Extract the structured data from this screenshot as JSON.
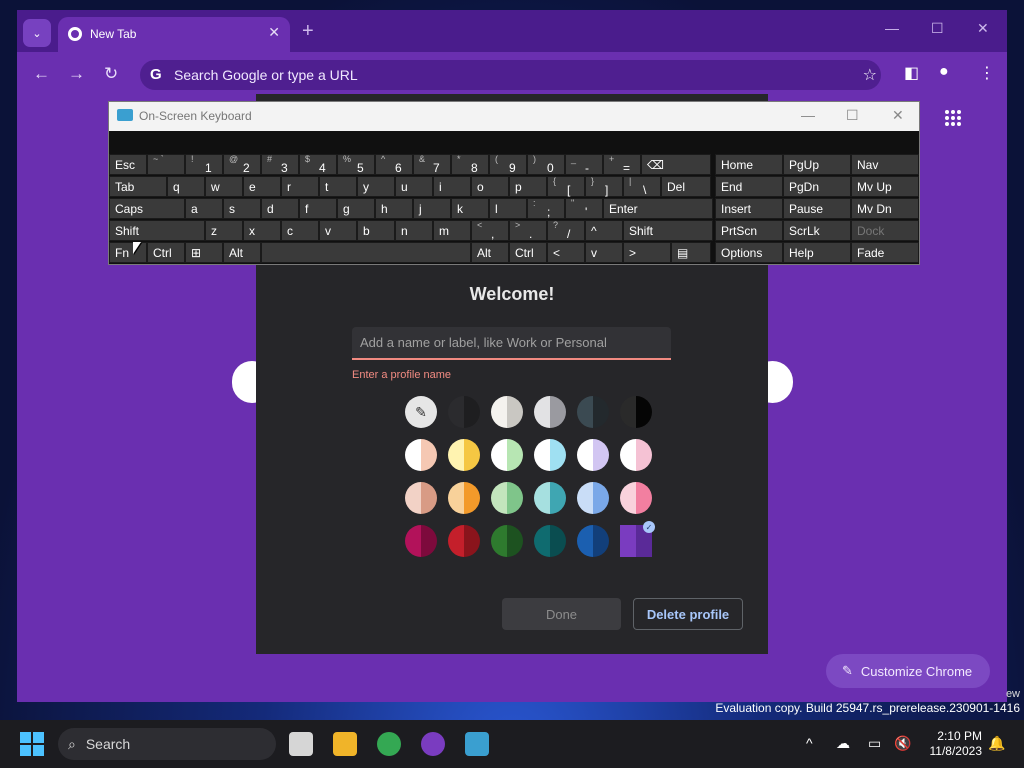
{
  "browser": {
    "tab_title": "New Tab",
    "tab_close": "✕",
    "new_tab": "+",
    "window_controls": [
      "—",
      "☐",
      "✕"
    ],
    "omnibox_placeholder": "Search Google or type a URL",
    "customize_label": "Customize Chrome",
    "theme_color": "#6a2fb0"
  },
  "osk": {
    "title": "On-Screen Keyboard",
    "controls": [
      "—",
      "☐",
      "✕"
    ],
    "rows": [
      [
        [
          "Esc",
          ""
        ],
        [
          "",
          "~ `"
        ],
        [
          "1",
          "!"
        ],
        [
          "2",
          "@"
        ],
        [
          "3",
          "#"
        ],
        [
          "4",
          "$"
        ],
        [
          "5",
          "%"
        ],
        [
          "6",
          "^"
        ],
        [
          "7",
          "&"
        ],
        [
          "8",
          "*"
        ],
        [
          "9",
          "("
        ],
        [
          "0",
          ")"
        ],
        [
          "-",
          "_"
        ],
        [
          "=",
          "+"
        ],
        [
          "⌫",
          ""
        ]
      ],
      [
        [
          "Tab",
          ""
        ],
        [
          "q",
          ""
        ],
        [
          "w",
          ""
        ],
        [
          "e",
          ""
        ],
        [
          "r",
          ""
        ],
        [
          "t",
          ""
        ],
        [
          "y",
          ""
        ],
        [
          "u",
          ""
        ],
        [
          "i",
          ""
        ],
        [
          "o",
          ""
        ],
        [
          "p",
          ""
        ],
        [
          "[",
          "{"
        ],
        [
          "]",
          "}"
        ],
        [
          "\\",
          "|"
        ],
        [
          "Del",
          ""
        ]
      ],
      [
        [
          "Caps",
          ""
        ],
        [
          "a",
          ""
        ],
        [
          "s",
          ""
        ],
        [
          "d",
          ""
        ],
        [
          "f",
          ""
        ],
        [
          "g",
          ""
        ],
        [
          "h",
          ""
        ],
        [
          "j",
          ""
        ],
        [
          "k",
          ""
        ],
        [
          "l",
          ""
        ],
        [
          ";",
          ":"
        ],
        [
          "'",
          "\""
        ],
        [
          "Enter",
          ""
        ]
      ],
      [
        [
          "Shift",
          ""
        ],
        [
          "z",
          ""
        ],
        [
          "x",
          ""
        ],
        [
          "c",
          ""
        ],
        [
          "v",
          ""
        ],
        [
          "b",
          ""
        ],
        [
          "n",
          ""
        ],
        [
          "m",
          ""
        ],
        [
          ",",
          "<"
        ],
        [
          ".",
          ">"
        ],
        [
          "/",
          "?"
        ],
        [
          "^",
          ""
        ],
        [
          "Shift",
          ""
        ]
      ],
      [
        [
          "Fn",
          ""
        ],
        [
          "Ctrl",
          ""
        ],
        [
          "⊞",
          ""
        ],
        [
          "Alt",
          ""
        ],
        [
          "",
          ""
        ],
        [
          "Alt",
          ""
        ],
        [
          "Ctrl",
          ""
        ],
        [
          "<",
          ""
        ],
        [
          "v",
          ""
        ],
        [
          ">",
          ""
        ],
        [
          "▤",
          ""
        ]
      ]
    ],
    "nav_rows": [
      [
        "Home",
        "PgUp",
        "Nav"
      ],
      [
        "End",
        "PgDn",
        "Mv Up"
      ],
      [
        "Insert",
        "Pause",
        "Mv Dn"
      ],
      [
        "PrtScn",
        "ScrLk",
        "Dock"
      ],
      [
        "Options",
        "Help",
        "Fade"
      ]
    ]
  },
  "dialog": {
    "title": "Welcome!",
    "name_placeholder": "Add a name or label, like Work or Personal",
    "error": "Enter a profile name",
    "done_label": "Done",
    "delete_label": "Delete profile",
    "swatches": [
      [
        [
          "eyedropper"
        ],
        [
          "#2b2b2e",
          "#1e1e20"
        ],
        [
          "#f4f2ee",
          "#c9c7c2"
        ],
        [
          "#e2e2e4",
          "#9a9aa0"
        ],
        [
          "#3b4a52",
          "#23292d"
        ],
        [
          "#2a2a2a",
          "#050505"
        ]
      ],
      [
        [
          "#ffffff",
          "#f5c8b3"
        ],
        [
          "#fff3b0",
          "#f5c743"
        ],
        [
          "#ffffff",
          "#b7e6b3"
        ],
        [
          "#ffffff",
          "#9fe0f2"
        ],
        [
          "#ffffff",
          "#d2c6f2"
        ],
        [
          "#ffffff",
          "#f5c2d4"
        ]
      ],
      [
        [
          "#f2d2c6",
          "#d89b85"
        ],
        [
          "#f8d19a",
          "#f39a2a"
        ],
        [
          "#c3e5bd",
          "#7fc58a"
        ],
        [
          "#a6e0e0",
          "#3fa6b2"
        ],
        [
          "#c9ddf7",
          "#7aa8e8"
        ],
        [
          "#f9d2dc",
          "#f27fa0"
        ]
      ],
      [
        [
          "#b2125a",
          "#7d0a3c"
        ],
        [
          "#c41f2b",
          "#8a141c"
        ],
        [
          "#2e7a2e",
          "#1d5220"
        ],
        [
          "#0f6b6f",
          "#0a4d50"
        ],
        [
          "#1b5fb0",
          "#123f7a"
        ],
        [
          "#7a3cc0",
          "#5a2a98"
        ]
      ]
    ],
    "selected_swatch": "#7a3cc0"
  },
  "taskbar": {
    "search_label": "Search",
    "time": "2:10 PM",
    "date": "11/8/2023",
    "watermark": "Evaluation copy. Build 25947.rs_prerelease.230901-1416",
    "watermark_fragment": "ew"
  }
}
